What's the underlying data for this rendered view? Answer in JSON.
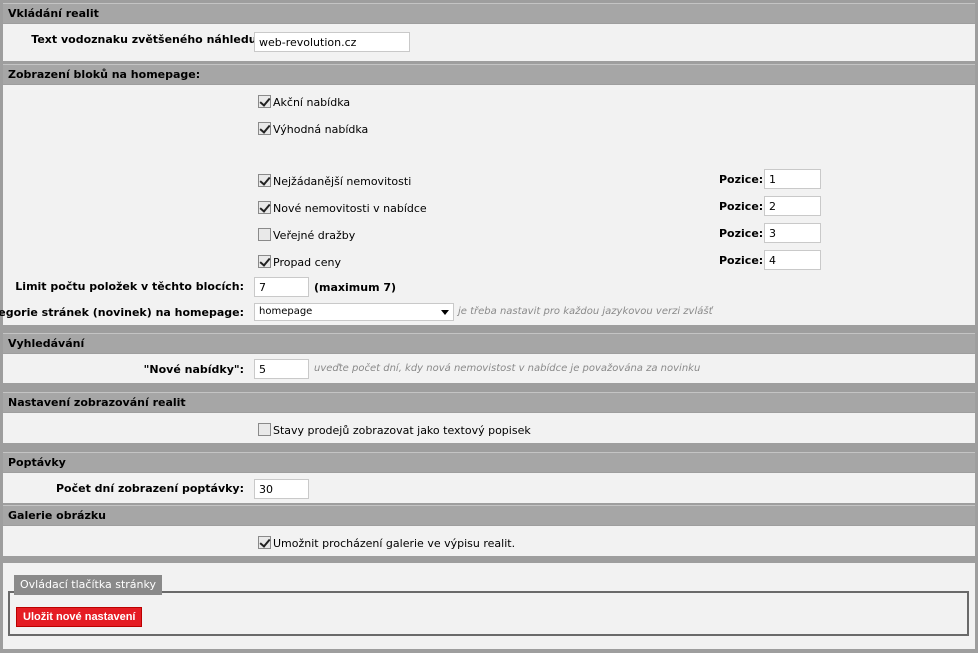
{
  "sections": {
    "vkladani": {
      "title": "Vkládání realit",
      "watermark_label": "Text vodoznaku zvětšeného náhledu:",
      "watermark_value": "web-revolution.cz"
    },
    "homepage": {
      "title": "Zobrazení bloků na homepage:",
      "akcni": "Akční nabídka",
      "vyhodna": "Výhodná nabídka",
      "blocks": [
        {
          "label": "Nejžádanější nemovitosti",
          "checked": true,
          "pos_label": "Pozice:",
          "pos": "1"
        },
        {
          "label": "Nové nemovitosti v nabídce",
          "checked": true,
          "pos_label": "Pozice:",
          "pos": "2"
        },
        {
          "label": "Veřejné dražby",
          "checked": false,
          "pos_label": "Pozice:",
          "pos": "3"
        },
        {
          "label": "Propad ceny",
          "checked": true,
          "pos_label": "Pozice:",
          "pos": "4"
        }
      ],
      "limit_label": "Limit počtu položek v těchto blocích:",
      "limit_value": "7",
      "limit_max": "(maximum 7)",
      "category_label": "Kategorie stránek (novinek) na homepage:",
      "category_value": "homepage",
      "category_hint": "je třeba nastavit pro každou jazykovou verzi zvlášť"
    },
    "vyhledavani": {
      "title": "Vyhledávání",
      "nove_label": "\"Nové nabídky\":",
      "nove_value": "5",
      "nove_hint": "uveďte počet dní, kdy nová nemovistost v nabídce je považována za novinku"
    },
    "zobrazeni": {
      "title": "Nastavení zobrazování realit",
      "stavy_label": "Stavy prodejů zobrazovat jako textový popisek"
    },
    "poptavky": {
      "title": "Poptávky",
      "dni_label": "Počet dní zobrazení poptávky:",
      "dni_value": "30"
    },
    "galerie": {
      "title": "Galerie obrázku",
      "umoznit_label": "Umožnit procházení galerie ve výpisu realit."
    }
  },
  "controls": {
    "legend": "Ovládací tlačítka stránky",
    "save_label": "Uložit nové nastavení"
  },
  "colors": {
    "header_bg": "#a6a6a6",
    "body_bg": "#f2f2f2",
    "save_button": "#e51c23"
  }
}
